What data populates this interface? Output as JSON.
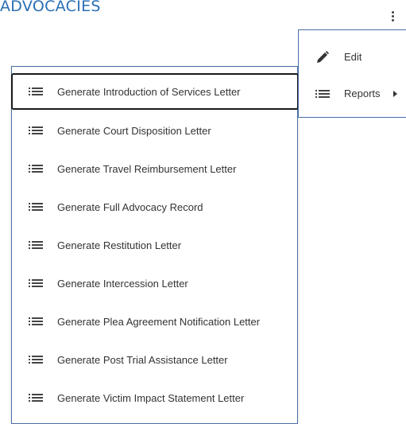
{
  "header": {
    "title": "ADVOCACIES"
  },
  "menu": {
    "items": [
      {
        "label": "Edit",
        "icon": "pencil-icon"
      },
      {
        "label": "Reports",
        "icon": "list-icon",
        "has_submenu": true
      }
    ]
  },
  "reports_submenu": {
    "items": [
      {
        "label": "Generate Introduction of Services Letter",
        "icon": "list-icon",
        "focused": true
      },
      {
        "label": "Generate Court Disposition Letter",
        "icon": "list-icon"
      },
      {
        "label": "Generate Travel Reimbursement Letter",
        "icon": "list-icon"
      },
      {
        "label": "Generate Full Advocacy Record",
        "icon": "list-icon"
      },
      {
        "label": "Generate Restitution Letter",
        "icon": "list-icon"
      },
      {
        "label": "Generate Intercession Letter",
        "icon": "list-icon"
      },
      {
        "label": "Generate Plea Agreement Notification Letter",
        "icon": "list-icon"
      },
      {
        "label": "Generate Post Trial Assistance Letter",
        "icon": "list-icon"
      },
      {
        "label": "Generate Victim Impact Statement Letter",
        "icon": "list-icon"
      }
    ]
  },
  "colors": {
    "title": "#2a6fb5",
    "menu_border": "#4a6fa5",
    "focus_border": "#1a1a1a",
    "text": "#333333"
  }
}
